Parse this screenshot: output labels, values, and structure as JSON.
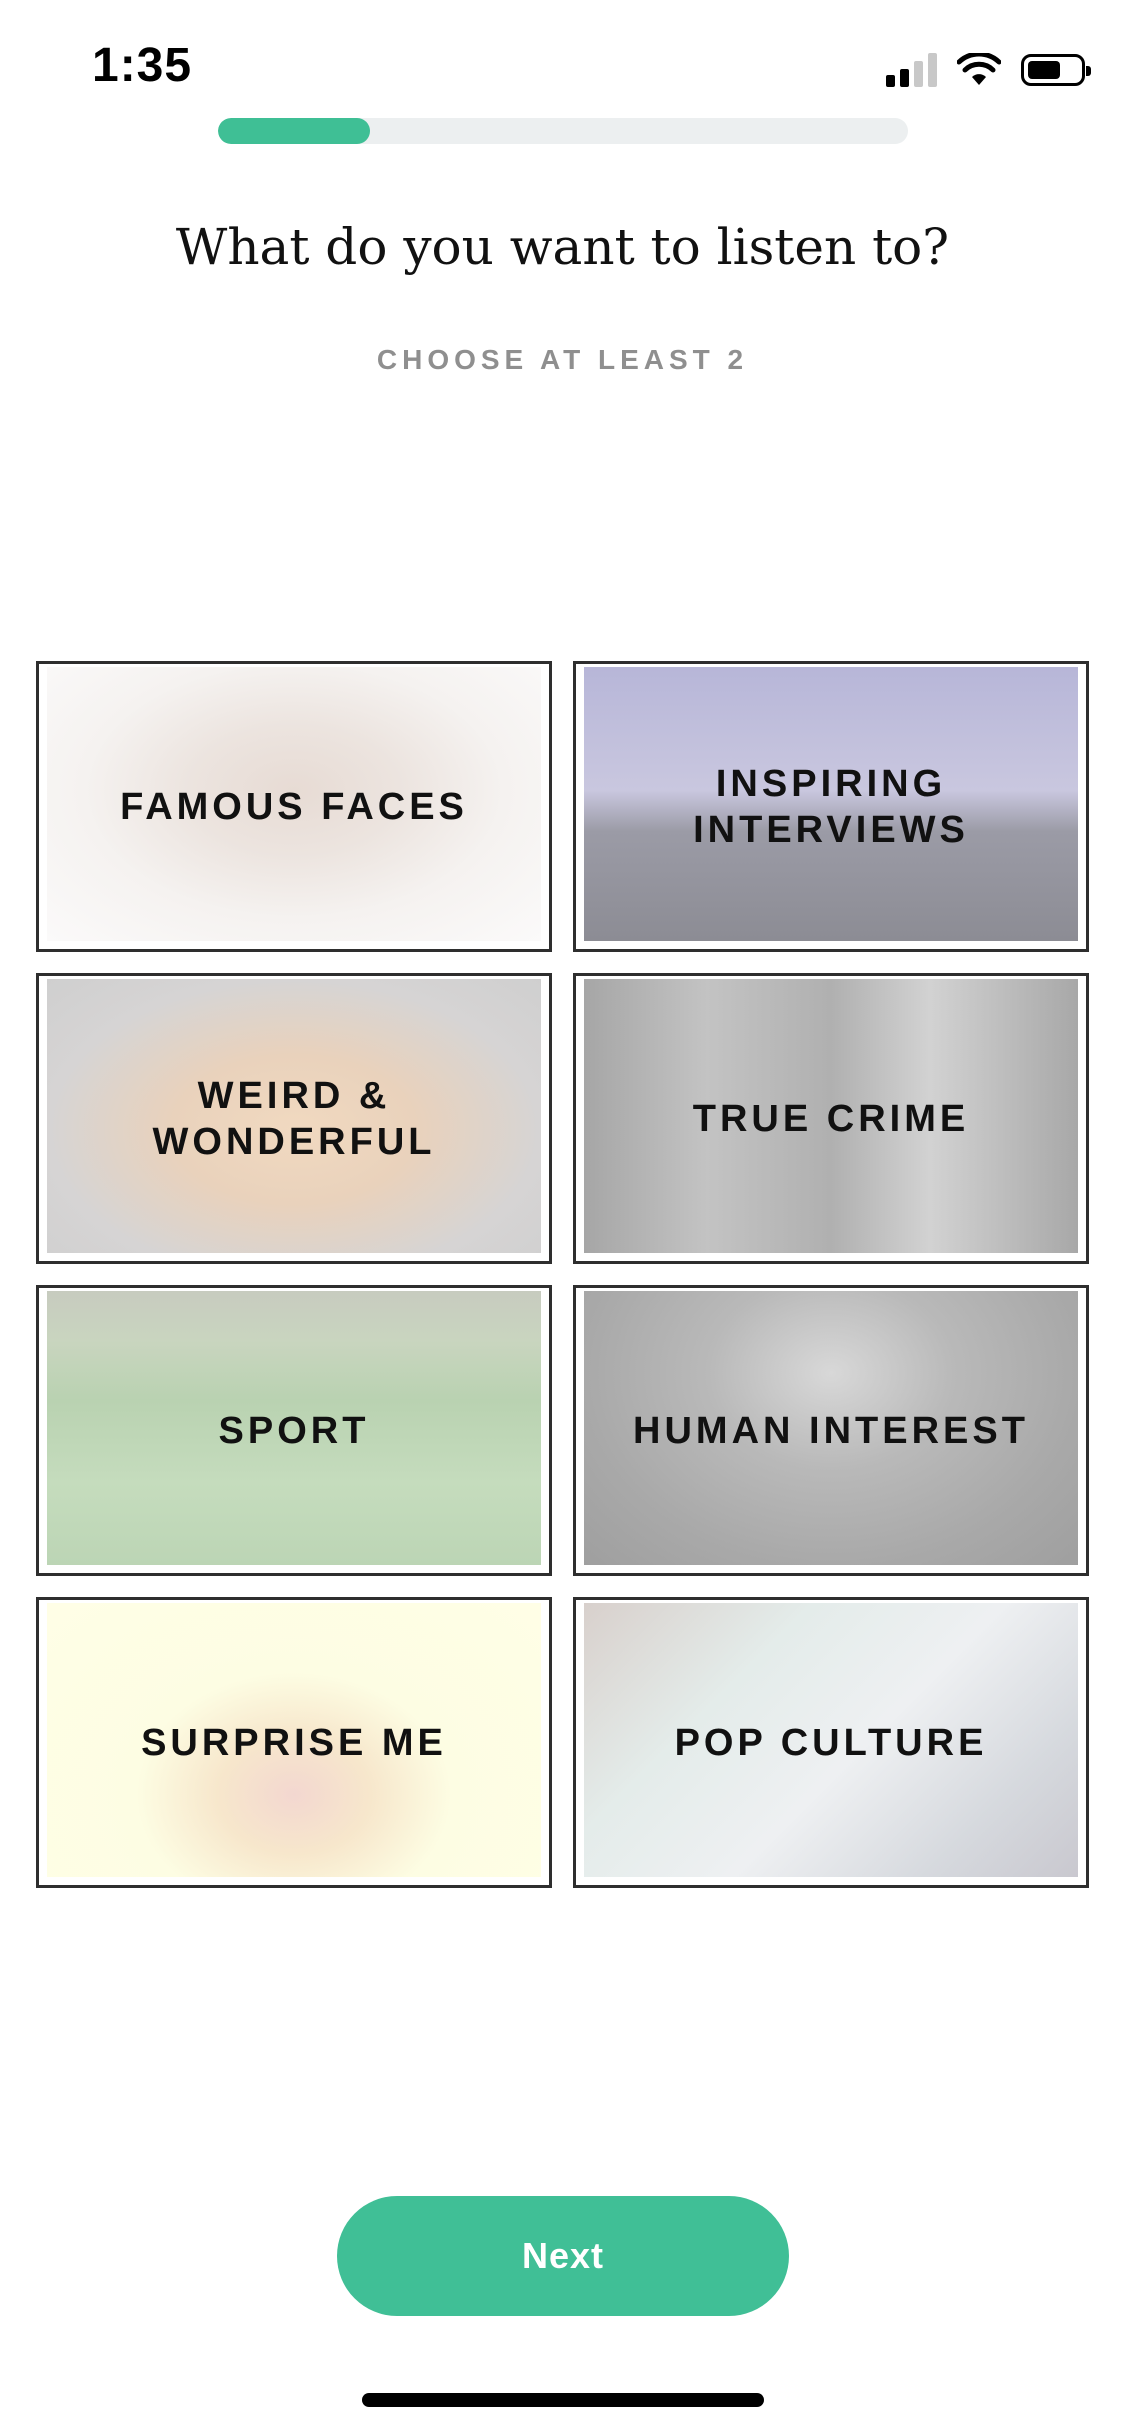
{
  "status_bar": {
    "time": "1:35",
    "icons": [
      "cellular-signal-icon",
      "wifi-icon",
      "battery-icon"
    ]
  },
  "onboarding": {
    "progress_percent": 22,
    "title": "What do you want to listen to?",
    "subtitle": "CHOOSE AT LEAST 2"
  },
  "categories": [
    {
      "label": "FAMOUS FACES"
    },
    {
      "label": "INSPIRING INTERVIEWS"
    },
    {
      "label": "WEIRD & WONDERFUL"
    },
    {
      "label": "TRUE CRIME"
    },
    {
      "label": "SPORT"
    },
    {
      "label": "HUMAN INTEREST"
    },
    {
      "label": "SURPRISE ME"
    },
    {
      "label": "POP CULTURE"
    }
  ],
  "actions": {
    "next_label": "Next"
  },
  "colors": {
    "accent": "#40bf96",
    "progress_track": "#eceff0",
    "tile_border": "#2e2e2e",
    "subtitle": "#8f8f8f"
  }
}
